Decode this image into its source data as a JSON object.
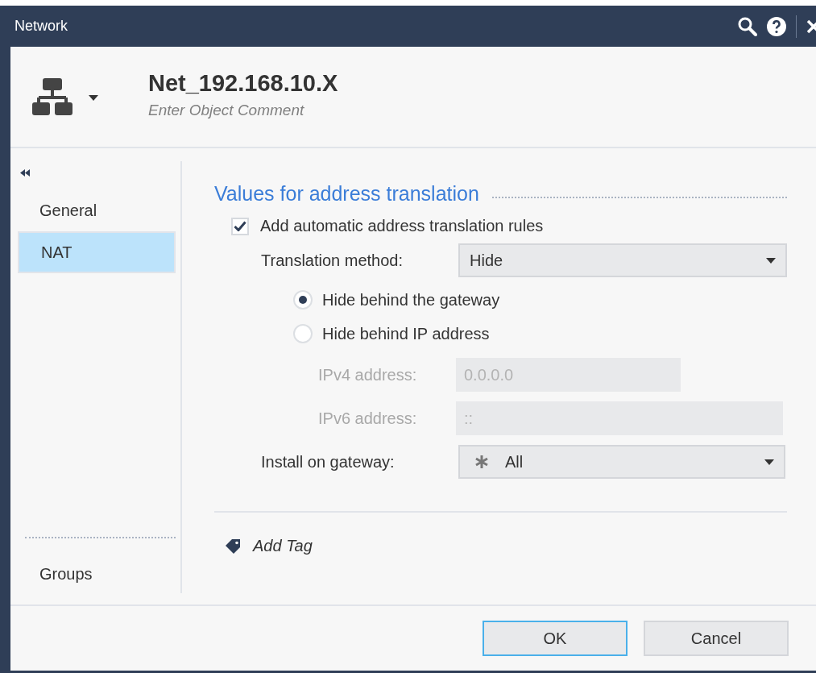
{
  "window": {
    "title": "Network"
  },
  "header": {
    "name": "Net_192.168.10.X",
    "comment_placeholder": "Enter Object Comment"
  },
  "sidebar": {
    "items": [
      {
        "label": "General",
        "selected": false
      },
      {
        "label": "NAT",
        "selected": true
      }
    ],
    "bottom_items": [
      {
        "label": "Groups",
        "selected": false
      }
    ]
  },
  "section": {
    "title": "Values for address translation"
  },
  "auto_rules": {
    "label": "Add automatic address translation rules",
    "checked": true
  },
  "translation_method": {
    "label": "Translation method:",
    "value": "Hide"
  },
  "hide_options": [
    {
      "label": "Hide behind the gateway",
      "selected": true
    },
    {
      "label": "Hide behind IP address",
      "selected": false
    }
  ],
  "address_fields": [
    {
      "label": "IPv4 address:",
      "value": "0.0.0.0",
      "disabled": true,
      "wide": false
    },
    {
      "label": "IPv6 address:",
      "value": "::",
      "disabled": true,
      "wide": true
    }
  ],
  "install_on": {
    "label": "Install on gateway:",
    "value": "All"
  },
  "add_tag": {
    "label": "Add Tag"
  },
  "buttons": [
    {
      "label": "OK",
      "default": true
    },
    {
      "label": "Cancel",
      "default": false
    }
  ]
}
